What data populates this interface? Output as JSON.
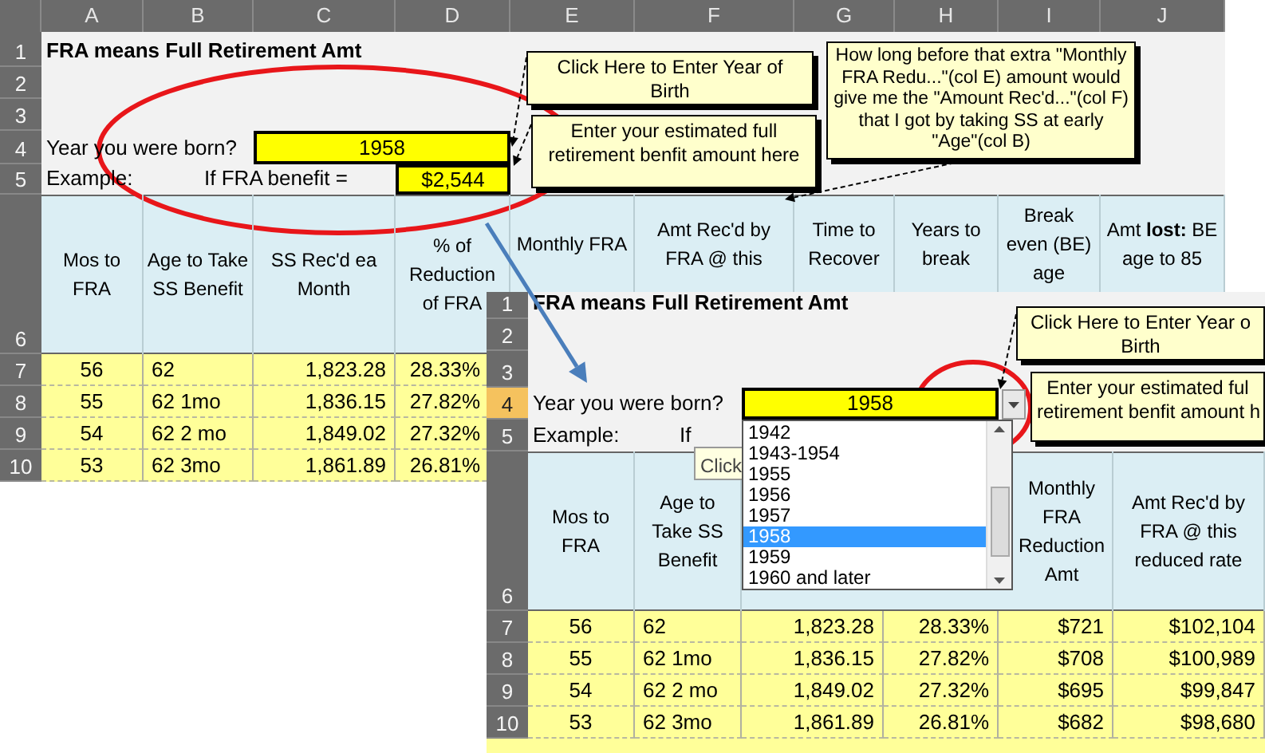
{
  "sheets": [
    {
      "column_headers": [
        "A",
        "B",
        "C",
        "D",
        "E",
        "F",
        "G",
        "H",
        "I",
        "J"
      ],
      "row_headers": [
        {
          "label": "1",
          "selected": false
        },
        {
          "label": "2",
          "selected": false
        },
        {
          "label": "3",
          "selected": false
        },
        {
          "label": "4",
          "selected": false
        },
        {
          "label": "5",
          "selected": false
        },
        {
          "label": "6",
          "selected": false
        },
        {
          "label": "7",
          "selected": false
        },
        {
          "label": "8",
          "selected": false
        },
        {
          "label": "9",
          "selected": false
        },
        {
          "label": "10",
          "selected": false
        }
      ],
      "title": "FRA means Full Retirement Amt",
      "birth_year": {
        "label": "Year you were born?",
        "value": "1958"
      },
      "example": {
        "label": "Example:",
        "benefit_label": "If FRA benefit =",
        "benefit_value": "$2,544"
      },
      "table_headers": [
        "Mos to FRA",
        "Age to Take SS Benefit",
        "SS Rec'd ea Month",
        "% of Reduction of FRA",
        "Monthly FRA",
        "Amt Rec'd by FRA @ this",
        "Time to Recover",
        "Years to break",
        "Break even (BE) age",
        "Amt **lost:** BE age to 85"
      ],
      "rows": [
        [
          "56",
          "62",
          "1,823.28",
          "28.33%"
        ],
        [
          "55",
          "62 1mo",
          "1,836.15",
          "27.82%"
        ],
        [
          "54",
          "62 2 mo",
          "1,849.02",
          "27.32%"
        ],
        [
          "53",
          "62 3mo",
          "1,861.89",
          "26.81%"
        ]
      ],
      "comments": [
        {
          "lines": [
            "Click Here to Enter Year of",
            "Birth"
          ]
        },
        {
          "lines": [
            "Enter your estimated full",
            "retirement benfit amount here"
          ]
        },
        {
          "lines": [
            "How long before that extra \"Monthly",
            "FRA Redu...\"(col E) amount would",
            "give me the \"Amount Rec'd...\"(col F)",
            "that I got by taking SS at early",
            "\"Age\"(col B)"
          ]
        }
      ]
    },
    {
      "row_headers": [
        {
          "label": "1",
          "selected": false
        },
        {
          "label": "2",
          "selected": false
        },
        {
          "label": "3",
          "selected": false
        },
        {
          "label": "4",
          "selected": true
        },
        {
          "label": "5",
          "selected": false
        },
        {
          "label": "6",
          "selected": false
        },
        {
          "label": "7",
          "selected": false
        },
        {
          "label": "8",
          "selected": false
        },
        {
          "label": "9",
          "selected": false
        },
        {
          "label": "10",
          "selected": false
        }
      ],
      "title": "FRA means Full Retirement Amt",
      "birth_year": {
        "label": "Year you were born?",
        "value": "1958"
      },
      "example": {
        "label": "Example:",
        "benefit_label": "If"
      },
      "tooltip": "Click",
      "dropdown": {
        "options": [
          {
            "label": "1942",
            "selected": false
          },
          {
            "label": "1943-1954",
            "selected": false
          },
          {
            "label": "1955",
            "selected": false
          },
          {
            "label": "1956",
            "selected": false
          },
          {
            "label": "1957",
            "selected": false
          },
          {
            "label": "1958",
            "selected": true
          },
          {
            "label": "1959",
            "selected": false
          },
          {
            "label": "1960 and later",
            "selected": false
          }
        ]
      },
      "table_headers": [
        "Mos to FRA",
        "Age to Take SS Benefit",
        "Monthly FRA Reduction Amt",
        "Amt Rec'd by FRA @ this reduced rate"
      ],
      "rows": [
        [
          "56",
          "62",
          "1,823.28",
          "28.33%",
          "$721",
          "$102,104"
        ],
        [
          "55",
          "62 1mo",
          "1,836.15",
          "27.82%",
          "$708",
          "$100,989"
        ],
        [
          "54",
          "62 2 mo",
          "1,849.02",
          "27.32%",
          "$695",
          "$99,847"
        ],
        [
          "53",
          "62 3mo",
          "1,861.89",
          "26.81%",
          "$682",
          "$98,680"
        ]
      ],
      "comments": [
        {
          "lines": [
            "Click Here to Enter Year o",
            "Birth"
          ]
        },
        {
          "lines": [
            "Enter your estimated ful",
            "retirement benfit amount h"
          ]
        }
      ]
    }
  ]
}
